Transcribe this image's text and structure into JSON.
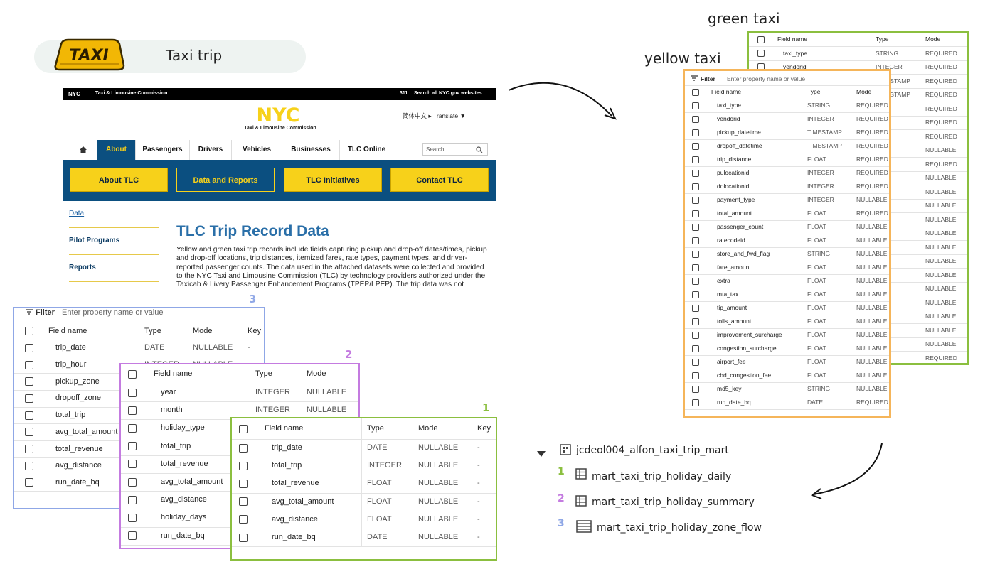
{
  "header": {
    "title": "Taxi trip",
    "sign_text": "TAXI"
  },
  "website": {
    "topbar_left": "NYC",
    "topbar_org": "Taxi & Limousine Commission",
    "topbar_right_num": "311",
    "topbar_right_text": "Search all NYC.gov websites",
    "logo_text": "NYC",
    "logo_sub": "Taxi & Limousine Commission",
    "lang": "简体中文 ▸ Translate ▼",
    "nav": [
      "About",
      "Passengers",
      "Drivers",
      "Vehicles",
      "Businesses",
      "TLC Online"
    ],
    "search_placeholder": "Search",
    "buttons": [
      "About TLC",
      "Data and Reports",
      "TLC Initiatives",
      "Contact TLC"
    ],
    "side_links": [
      "Data",
      "Pilot Programs",
      "Reports"
    ],
    "page_title": "TLC Trip Record Data",
    "paragraph": "Yellow and green taxi trip records include fields capturing pickup and drop-off dates/times, pickup and drop-off locations, trip distances, itemized fares, rate types, payment types, and driver-reported passenger counts. The data used in the attached datasets were collected and provided to the NYC Taxi and Limousine Commission (TLC) by technology providers authorized under the Taxicab & Livery Passenger Enhancement Programs (TPEP/LPEP). The trip data was not created"
  },
  "labels": {
    "green_taxi": "green taxi",
    "yellow_taxi": "yellow taxi"
  },
  "filter": {
    "label": "Filter",
    "placeholder": "Enter property name or value"
  },
  "columns": {
    "field": "Field name",
    "type": "Type",
    "mode": "Mode",
    "key": "Key"
  },
  "green_schema": [
    {
      "name": "taxi_type",
      "type": "STRING",
      "mode": "REQUIRED"
    },
    {
      "name": "vendorid",
      "type": "INTEGER",
      "mode": "REQUIRED"
    },
    {
      "name": "",
      "type": "TIMESTAMP",
      "mode": "REQUIRED"
    },
    {
      "name": "",
      "type": "TIMESTAMP",
      "mode": "REQUIRED"
    },
    {
      "name": "",
      "type": "",
      "mode": "REQUIRED"
    },
    {
      "name": "",
      "type": "",
      "mode": "REQUIRED"
    },
    {
      "name": "",
      "type": "",
      "mode": "REQUIRED"
    },
    {
      "name": "",
      "type": "",
      "mode": "NULLABLE"
    },
    {
      "name": "",
      "type": "",
      "mode": "REQUIRED"
    },
    {
      "name": "",
      "type": "",
      "mode": "NULLABLE"
    },
    {
      "name": "",
      "type": "",
      "mode": "NULLABLE"
    },
    {
      "name": "",
      "type": "",
      "mode": "NULLABLE"
    },
    {
      "name": "",
      "type": "",
      "mode": "NULLABLE"
    },
    {
      "name": "",
      "type": "",
      "mode": "NULLABLE"
    },
    {
      "name": "",
      "type": "",
      "mode": "NULLABLE"
    },
    {
      "name": "",
      "type": "",
      "mode": "NULLABLE"
    },
    {
      "name": "",
      "type": "",
      "mode": "NULLABLE"
    },
    {
      "name": "",
      "type": "",
      "mode": "NULLABLE"
    },
    {
      "name": "",
      "type": "",
      "mode": "NULLABLE"
    },
    {
      "name": "",
      "type": "",
      "mode": "NULLABLE"
    },
    {
      "name": "",
      "type": "",
      "mode": "NULLABLE"
    },
    {
      "name": "",
      "type": "",
      "mode": "NULLABLE"
    },
    {
      "name": "",
      "type": "",
      "mode": "REQUIRED"
    }
  ],
  "yellow_schema": [
    {
      "name": "taxi_type",
      "type": "STRING",
      "mode": "REQUIRED"
    },
    {
      "name": "vendorid",
      "type": "INTEGER",
      "mode": "REQUIRED"
    },
    {
      "name": "pickup_datetime",
      "type": "TIMESTAMP",
      "mode": "REQUIRED"
    },
    {
      "name": "dropoff_datetime",
      "type": "TIMESTAMP",
      "mode": "REQUIRED"
    },
    {
      "name": "trip_distance",
      "type": "FLOAT",
      "mode": "REQUIRED"
    },
    {
      "name": "pulocationid",
      "type": "INTEGER",
      "mode": "REQUIRED"
    },
    {
      "name": "dolocationid",
      "type": "INTEGER",
      "mode": "REQUIRED"
    },
    {
      "name": "payment_type",
      "type": "INTEGER",
      "mode": "NULLABLE"
    },
    {
      "name": "total_amount",
      "type": "FLOAT",
      "mode": "REQUIRED"
    },
    {
      "name": "passenger_count",
      "type": "FLOAT",
      "mode": "NULLABLE"
    },
    {
      "name": "ratecodeid",
      "type": "FLOAT",
      "mode": "NULLABLE"
    },
    {
      "name": "store_and_fwd_flag",
      "type": "STRING",
      "mode": "NULLABLE"
    },
    {
      "name": "fare_amount",
      "type": "FLOAT",
      "mode": "NULLABLE"
    },
    {
      "name": "extra",
      "type": "FLOAT",
      "mode": "NULLABLE"
    },
    {
      "name": "mta_tax",
      "type": "FLOAT",
      "mode": "NULLABLE"
    },
    {
      "name": "tip_amount",
      "type": "FLOAT",
      "mode": "NULLABLE"
    },
    {
      "name": "tolls_amount",
      "type": "FLOAT",
      "mode": "NULLABLE"
    },
    {
      "name": "improvement_surcharge",
      "type": "FLOAT",
      "mode": "NULLABLE"
    },
    {
      "name": "congestion_surcharge",
      "type": "FLOAT",
      "mode": "NULLABLE"
    },
    {
      "name": "airport_fee",
      "type": "FLOAT",
      "mode": "NULLABLE"
    },
    {
      "name": "cbd_congestion_fee",
      "type": "FLOAT",
      "mode": "NULLABLE"
    },
    {
      "name": "md5_key",
      "type": "STRING",
      "mode": "NULLABLE"
    },
    {
      "name": "run_date_bq",
      "type": "DATE",
      "mode": "REQUIRED"
    }
  ],
  "table3": {
    "number": "3",
    "rows": [
      {
        "name": "trip_date",
        "type": "DATE",
        "mode": "NULLABLE",
        "key": "-"
      },
      {
        "name": "trip_hour",
        "type": "INTEGER",
        "mode": "NULLABLE",
        "key": ""
      },
      {
        "name": "pickup_zone",
        "type": "",
        "mode": "",
        "key": ""
      },
      {
        "name": "dropoff_zone",
        "type": "",
        "mode": "",
        "key": ""
      },
      {
        "name": "total_trip",
        "type": "",
        "mode": "",
        "key": ""
      },
      {
        "name": "avg_total_amount",
        "type": "",
        "mode": "",
        "key": ""
      },
      {
        "name": "total_revenue",
        "type": "",
        "mode": "",
        "key": ""
      },
      {
        "name": "avg_distance",
        "type": "",
        "mode": "",
        "key": ""
      },
      {
        "name": "run_date_bq",
        "type": "",
        "mode": "",
        "key": ""
      }
    ]
  },
  "table2": {
    "number": "2",
    "rows": [
      {
        "name": "year",
        "type": "INTEGER",
        "mode": "NULLABLE"
      },
      {
        "name": "month",
        "type": "INTEGER",
        "mode": "NULLABLE"
      },
      {
        "name": "holiday_type",
        "type": "",
        "mode": ""
      },
      {
        "name": "total_trip",
        "type": "",
        "mode": ""
      },
      {
        "name": "total_revenue",
        "type": "",
        "mode": ""
      },
      {
        "name": "avg_total_amount",
        "type": "",
        "mode": ""
      },
      {
        "name": "avg_distance",
        "type": "",
        "mode": ""
      },
      {
        "name": "holiday_days",
        "type": "",
        "mode": ""
      },
      {
        "name": "run_date_bq",
        "type": "",
        "mode": ""
      }
    ]
  },
  "table1": {
    "number": "1",
    "rows": [
      {
        "name": "trip_date",
        "type": "DATE",
        "mode": "NULLABLE",
        "key": "-"
      },
      {
        "name": "total_trip",
        "type": "INTEGER",
        "mode": "NULLABLE",
        "key": "-"
      },
      {
        "name": "total_revenue",
        "type": "FLOAT",
        "mode": "NULLABLE",
        "key": "-"
      },
      {
        "name": "avg_total_amount",
        "type": "FLOAT",
        "mode": "NULLABLE",
        "key": "-"
      },
      {
        "name": "avg_distance",
        "type": "FLOAT",
        "mode": "NULLABLE",
        "key": "-"
      },
      {
        "name": "run_date_bq",
        "type": "DATE",
        "mode": "NULLABLE",
        "key": "-"
      }
    ]
  },
  "dataset": {
    "name": "jcdeol004_alfon_taxi_trip_mart",
    "tables": [
      {
        "num": "1",
        "name": "mart_taxi_trip_holiday_daily"
      },
      {
        "num": "2",
        "name": "mart_taxi_trip_holiday_summary"
      },
      {
        "num": "3",
        "name": "mart_taxi_trip_holiday_zone_flow"
      }
    ]
  },
  "colors": {
    "green": "#8bbf3f",
    "yellow": "#f5b55a",
    "blue": "#8fa7e6",
    "purple": "#c47be0",
    "nyc_blue": "#0b4f80",
    "nyc_yellow": "#f7d11a"
  }
}
